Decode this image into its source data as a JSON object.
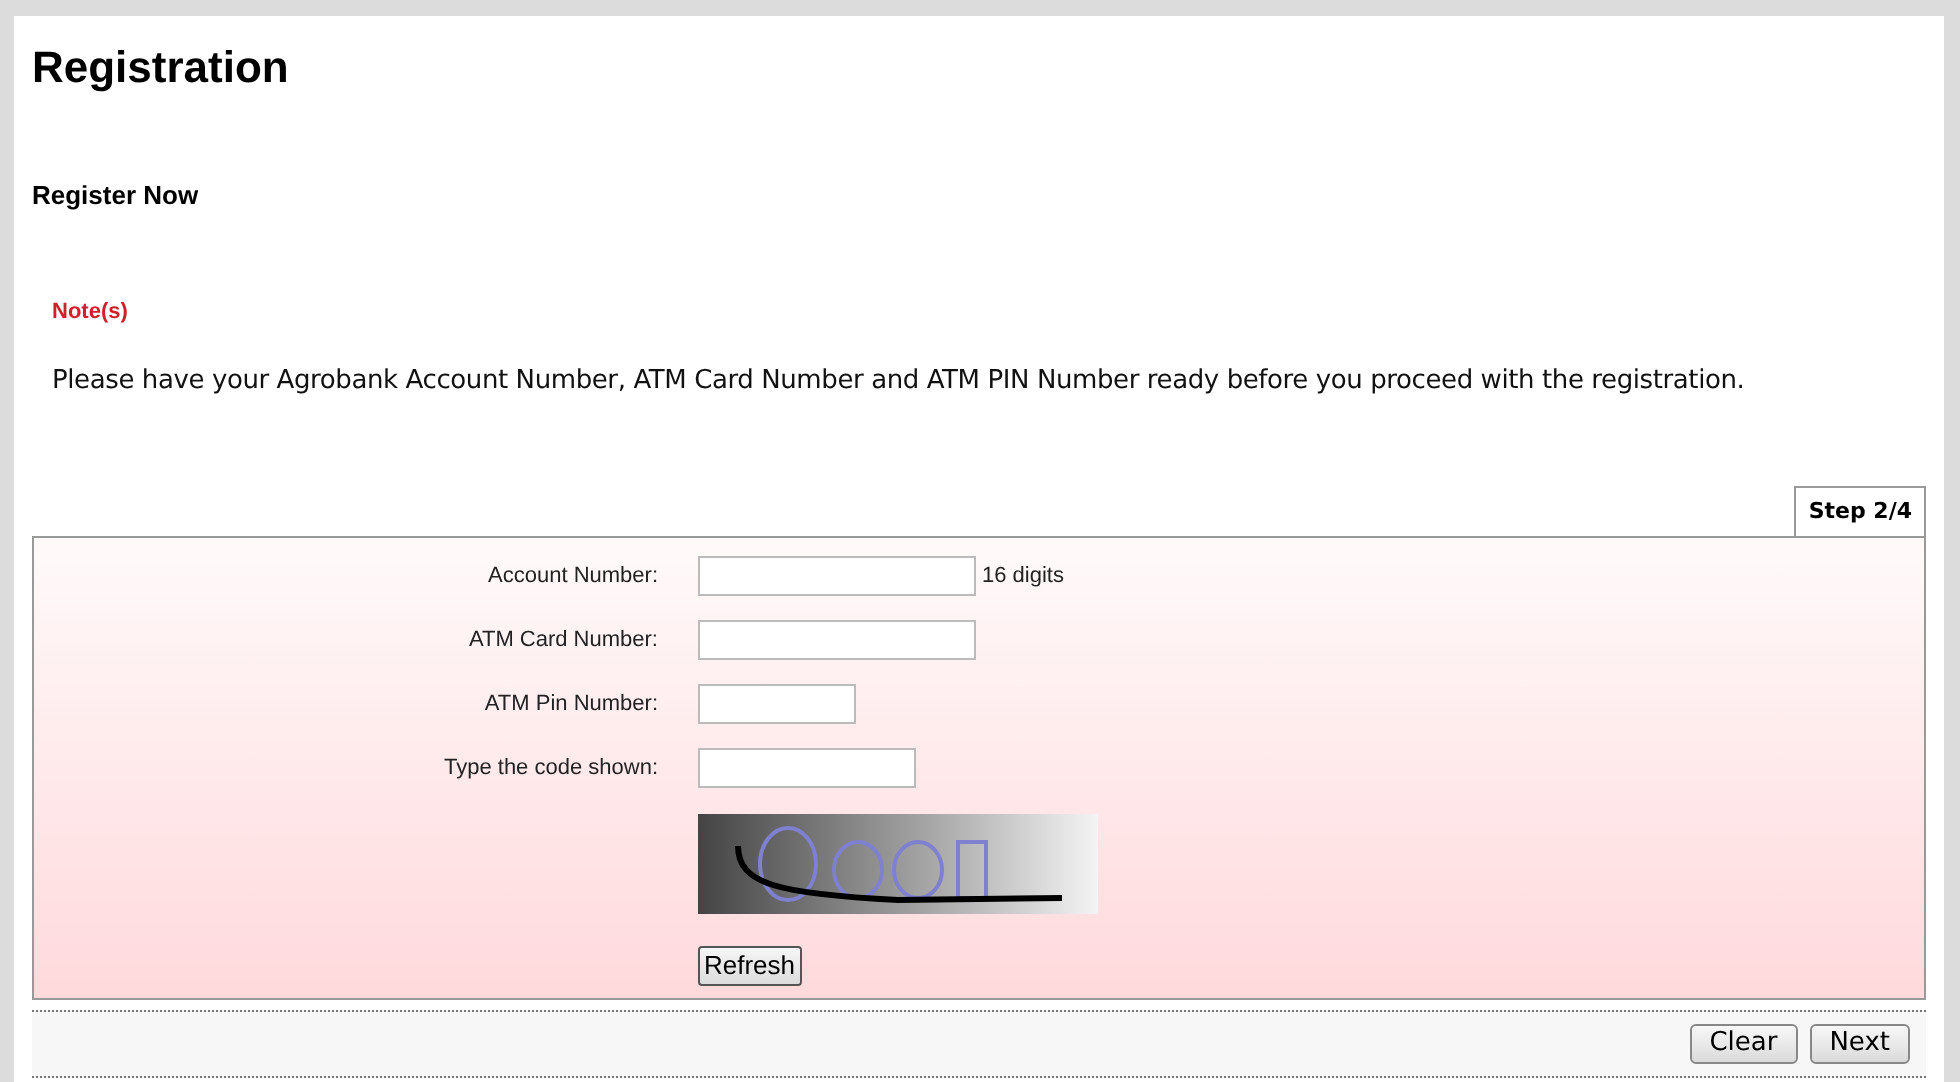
{
  "page": {
    "title": "Registration",
    "subtitle": "Register Now"
  },
  "note": {
    "heading": "Note(s)",
    "text": "Please have your Agrobank Account Number, ATM Card Number and ATM PIN Number ready before you proceed with the registration."
  },
  "step": "Step 2/4",
  "fields": [
    {
      "label": "Account Number:",
      "hint": "16 digits"
    },
    {
      "label": "ATM Card Number:"
    },
    {
      "label": "ATM Pin Number:"
    },
    {
      "label": "Type the code shown:"
    }
  ],
  "captcha": {
    "kind": "picture",
    "refresh_button": "Refresh"
  },
  "buttons": [
    "Clear",
    "Next"
  ]
}
